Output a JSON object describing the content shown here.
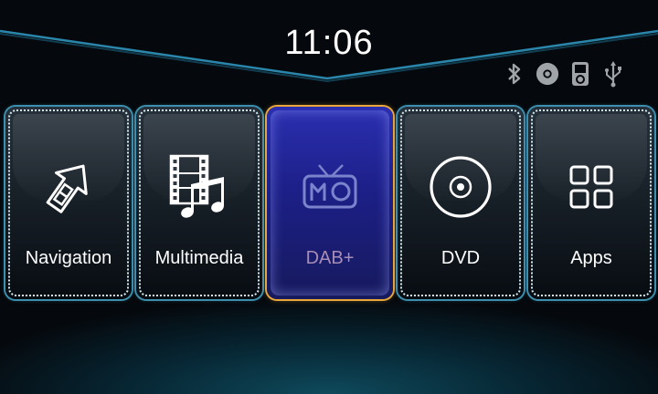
{
  "header": {
    "clock": "11:06",
    "status_icons": [
      "bluetooth-icon",
      "disc-icon",
      "music-player-icon",
      "usb-icon"
    ]
  },
  "tiles": [
    {
      "label": "Navigation",
      "icon": "navigation-arrow-icon",
      "active": false
    },
    {
      "label": "Multimedia",
      "icon": "film-music-icon",
      "active": false
    },
    {
      "label": "DAB+",
      "icon": "radio-icon",
      "active": true
    },
    {
      "label": "DVD",
      "icon": "dvd-disc-icon",
      "active": false
    },
    {
      "label": "Apps",
      "icon": "apps-grid-icon",
      "active": false
    }
  ],
  "colors": {
    "background": "#05080c",
    "tile_border": "#3c8fae",
    "active_tile": "#1c1f86",
    "active_border": "#e9a63a",
    "active_label": "#a78db6",
    "top_line": "#2a86aa"
  }
}
